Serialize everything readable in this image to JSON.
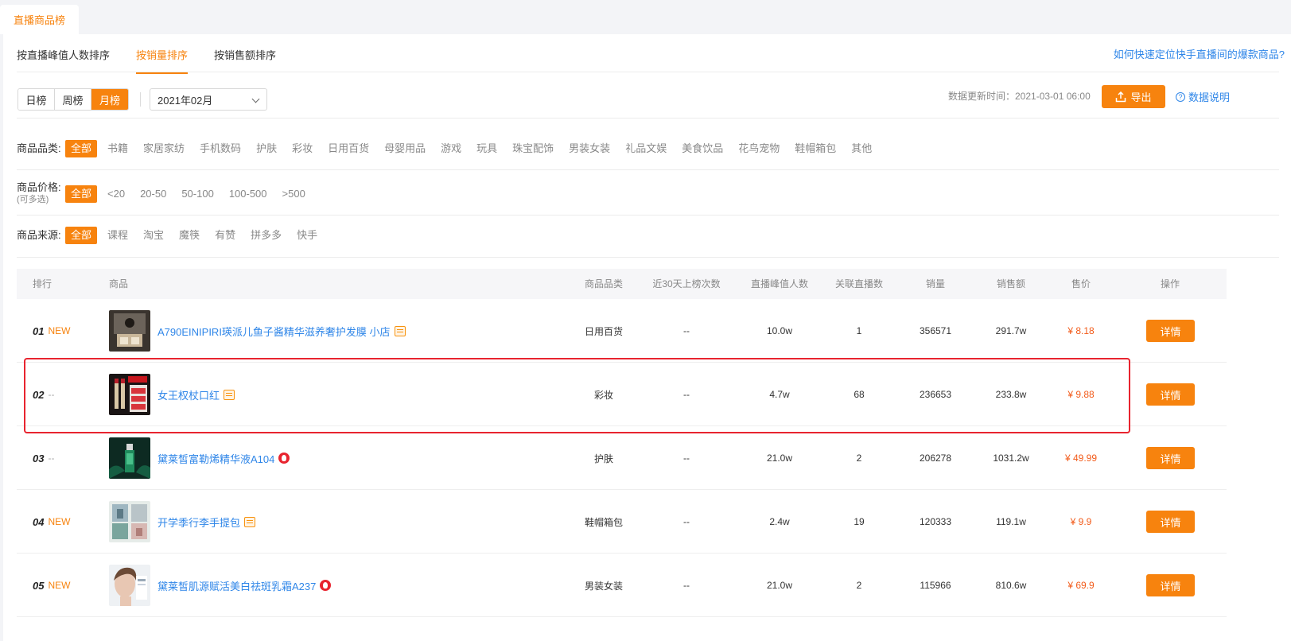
{
  "top_tab": "直播商品榜",
  "sort_tabs": [
    {
      "label": "按直播峰值人数排序",
      "active": false
    },
    {
      "label": "按销量排序",
      "active": true
    },
    {
      "label": "按销售额排序",
      "active": false
    }
  ],
  "help_link": "如何快速定位快手直播间的爆款商品?",
  "period": {
    "options": [
      "日榜",
      "周榜",
      "月榜"
    ],
    "active_index": 2
  },
  "month_select": "2021年02月",
  "update_time": "数据更新时间：2021-03-01 06:00",
  "export_label": "导出",
  "data_explain": "数据说明",
  "filters": {
    "category": {
      "label": "商品品类:",
      "options": [
        "全部",
        "书籍",
        "家居家纺",
        "手机数码",
        "护肤",
        "彩妆",
        "日用百货",
        "母婴用品",
        "游戏",
        "玩具",
        "珠宝配饰",
        "男装女装",
        "礼品文娱",
        "美食饮品",
        "花鸟宠物",
        "鞋帽箱包",
        "其他"
      ]
    },
    "price": {
      "label": "商品价格:",
      "sub": "(可多选)",
      "options": [
        "全部",
        "<20",
        "20-50",
        "50-100",
        "100-500",
        ">500"
      ]
    },
    "source": {
      "label": "商品来源:",
      "options": [
        "全部",
        "课程",
        "淘宝",
        "魔筷",
        "有赞",
        "拼多多",
        "快手"
      ]
    }
  },
  "table": {
    "headers": [
      "排行",
      "商品",
      "商品品类",
      "近30天上榜次数",
      "直播峰值人数",
      "关联直播数",
      "销量",
      "销售额",
      "售价",
      "操作"
    ],
    "detail_label": "详情",
    "rows": [
      {
        "rank": "01",
        "tag": "NEW",
        "name": "A790EINIPIRI瑛派儿鱼子酱精华滋养奢护发膜 小店",
        "source_icon": "box-icon",
        "category": "日用百货",
        "times30": "--",
        "peak": "10.0w",
        "related": "1",
        "sales": "356571",
        "revenue": "291.7w",
        "price": "¥ 8.18"
      },
      {
        "rank": "02",
        "tag": "--",
        "name": "女王权杖口红",
        "source_icon": "box-icon",
        "category": "彩妆",
        "times30": "--",
        "peak": "4.7w",
        "related": "68",
        "sales": "236653",
        "revenue": "233.8w",
        "price": "¥ 9.88"
      },
      {
        "rank": "03",
        "tag": "--",
        "name": "黛莱皙富勒烯精华液A104",
        "source_icon": "flame-icon",
        "category": "护肤",
        "times30": "--",
        "peak": "21.0w",
        "related": "2",
        "sales": "206278",
        "revenue": "1031.2w",
        "price": "¥ 49.99"
      },
      {
        "rank": "04",
        "tag": "NEW",
        "name": "开学季行李手提包",
        "source_icon": "box-icon",
        "category": "鞋帽箱包",
        "times30": "--",
        "peak": "2.4w",
        "related": "19",
        "sales": "120333",
        "revenue": "119.1w",
        "price": "¥ 9.9"
      },
      {
        "rank": "05",
        "tag": "NEW",
        "name": "黛莱皙肌源赋活美白祛斑乳霜A237",
        "source_icon": "flame-icon",
        "category": "男装女装",
        "times30": "--",
        "peak": "21.0w",
        "related": "2",
        "sales": "115966",
        "revenue": "810.6w",
        "price": "¥ 69.9"
      }
    ]
  },
  "colors": {
    "accent": "#f7830e",
    "link": "#2f86e8",
    "price": "#f25b1a",
    "highlight": "#e8242f"
  }
}
